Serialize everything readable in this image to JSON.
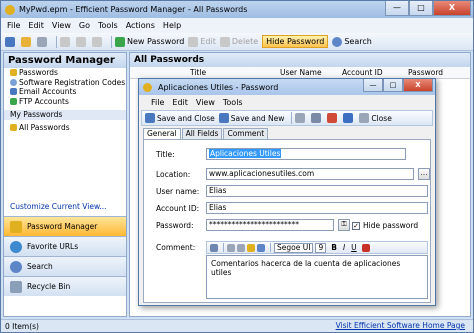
{
  "app": {
    "title": "MyPwd.epm - Efficient Password Manager - All Passwords",
    "window_buttons": {
      "minimize": "—",
      "maximize": "□",
      "close": "X"
    }
  },
  "menu": [
    "File",
    "Edit",
    "View",
    "Go",
    "Tools",
    "Actions",
    "Help"
  ],
  "toolbar": {
    "new_password": "New Password",
    "edit": "Edit",
    "delete": "Delete",
    "hide_password": "Hide Password",
    "search": "Search"
  },
  "nav": {
    "header": "Password Manager",
    "items": [
      "Passwords",
      "Software Registration Codes",
      "Email Accounts",
      "FTP Accounts"
    ],
    "section_label": "My Passwords",
    "sub_items": [
      "All Passwords"
    ],
    "customize_link": "Customize Current View...",
    "big_buttons": [
      "Password Manager",
      "Favorite URLs",
      "Search",
      "Recycle Bin"
    ]
  },
  "list": {
    "header": "All Passwords",
    "columns": [
      "Title",
      "User Name",
      "Account ID",
      "Password"
    ]
  },
  "status": {
    "left": "0 Item(s)",
    "right": "Visit Efficient Software Home Page"
  },
  "dialog": {
    "title": "Aplicaciones Utiles - Password",
    "menu": [
      "File",
      "Edit",
      "View",
      "Tools"
    ],
    "toolbar": {
      "save_close": "Save and Close",
      "save_new": "Save and New",
      "close": "Close"
    },
    "tabs": [
      "General",
      "All Fields",
      "Comment"
    ],
    "labels": {
      "title": "Title:",
      "location": "Location:",
      "user_name": "User name:",
      "account_id": "Account ID:",
      "password": "Password:",
      "comment": "Comment:"
    },
    "values": {
      "title": "Aplicaciones Utiles",
      "location": "www.aplicacionesutiles.com",
      "user_name": "Elias",
      "account_id": "Elias",
      "password": "************************",
      "comment": "Comentarios hacerca de la cuenta de aplicaciones utiles"
    },
    "hide_password_label": "Hide password",
    "hide_password_checked": true,
    "editor": {
      "font": "Segoe UI",
      "size": "9",
      "bold": "B",
      "italic": "I",
      "underline": "U"
    }
  }
}
